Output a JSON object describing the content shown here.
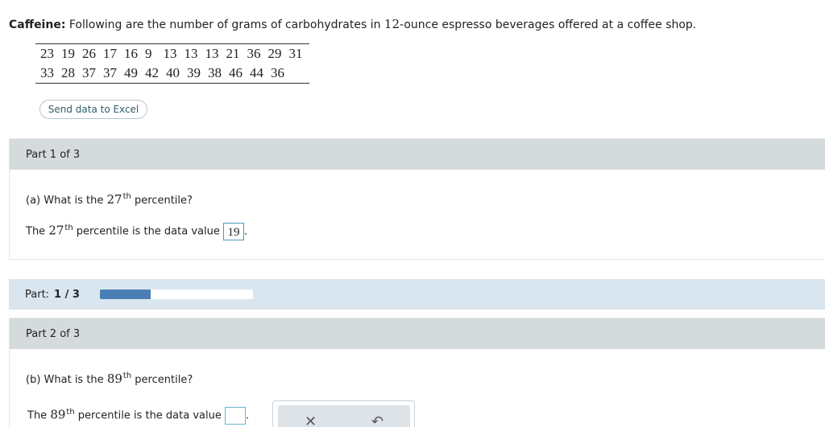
{
  "intro": {
    "label": "Caffeine:",
    "text_before": " Following are the number of grams of carbohydrates in ",
    "number": "12",
    "text_after": "-ounce espresso beverages offered at a coffee shop."
  },
  "data_table": {
    "row1": [
      "23",
      "19",
      "26",
      "17",
      "16",
      "9",
      "13",
      "13",
      "13",
      "21",
      "36",
      "29",
      "31"
    ],
    "row2": [
      "33",
      "28",
      "37",
      "37",
      "49",
      "42",
      "40",
      "39",
      "38",
      "46",
      "44",
      "36"
    ]
  },
  "excel_button": {
    "label": "Send data to Excel"
  },
  "part1": {
    "header": "Part 1 of 3",
    "question_prefix": "(a) What is the ",
    "question_num": "27",
    "question_sup": "th",
    "question_suffix": " percentile?",
    "answer_prefix": "The ",
    "answer_num": "27",
    "answer_sup": "th",
    "answer_suffix": " percentile is the data value ",
    "answer_value": "19",
    "answer_end": "."
  },
  "progress": {
    "label": "Part:",
    "value": "1 / 3",
    "fraction": 0.333,
    "color": "#4a7fb5"
  },
  "part2": {
    "header": "Part 2 of 3",
    "question_prefix": "(b) What is the ",
    "question_num": "89",
    "question_sup": "th",
    "question_suffix": " percentile?",
    "answer_prefix": "The ",
    "answer_num": "89",
    "answer_sup": "th",
    "answer_suffix": " percentile is the data value ",
    "answer_value": "",
    "answer_end": "."
  },
  "tools": {
    "clear_icon": "close-icon",
    "undo_icon": "undo-icon"
  }
}
